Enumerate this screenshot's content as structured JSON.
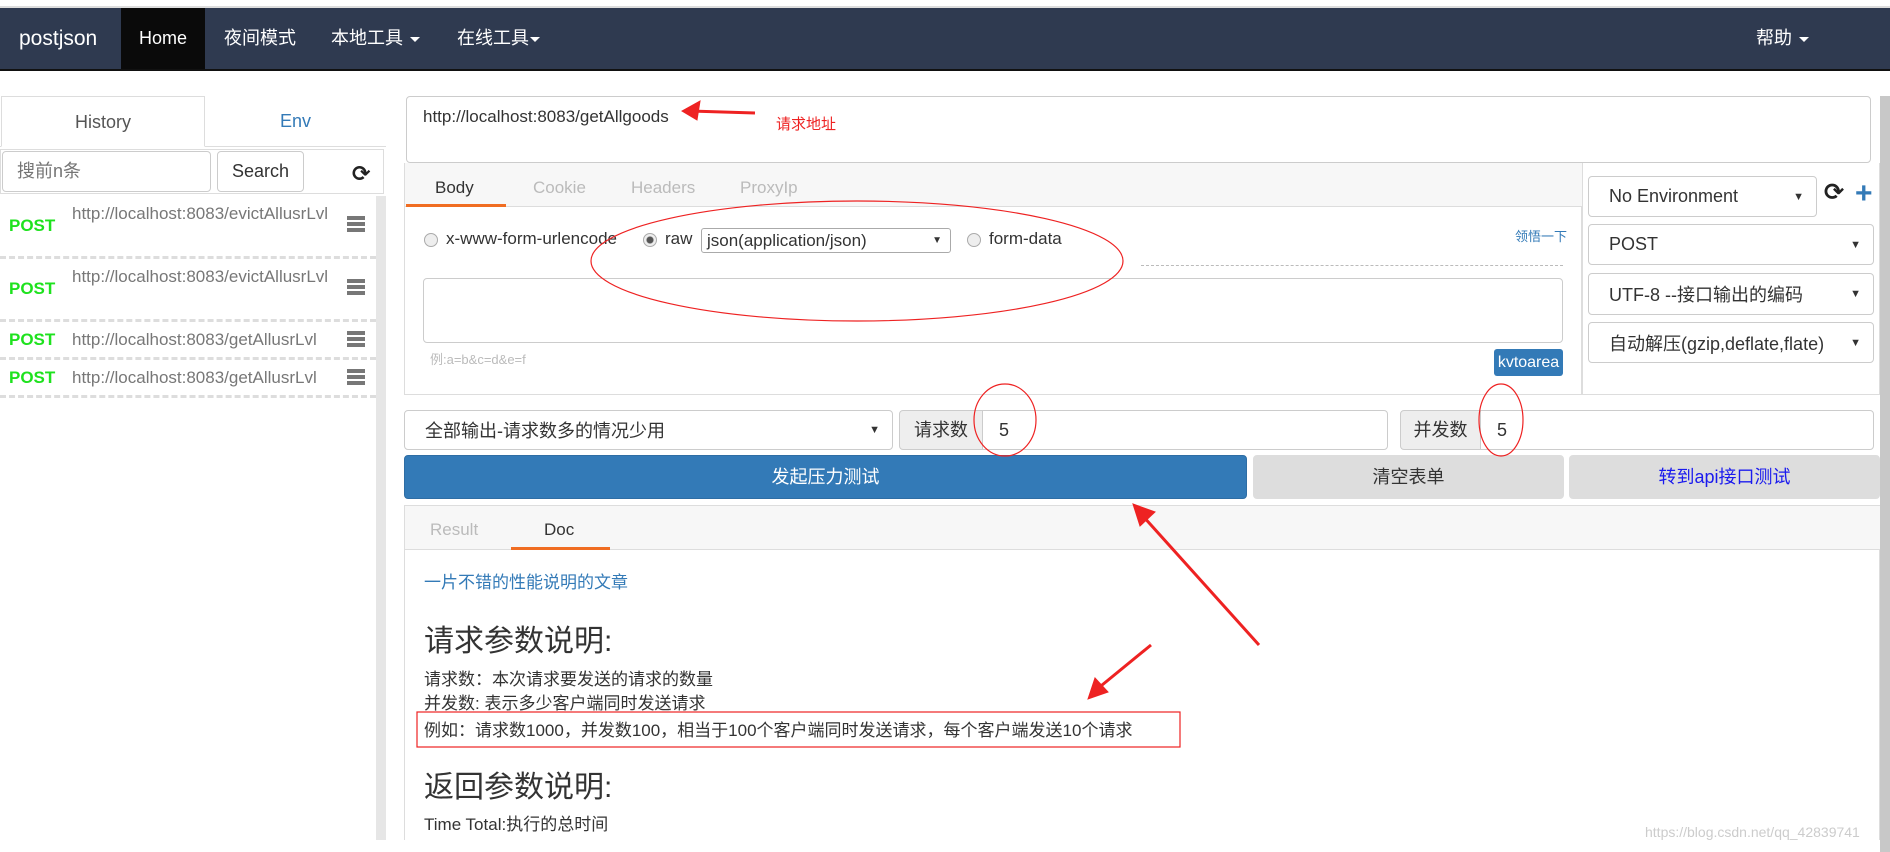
{
  "navbar": {
    "brand": "postjson",
    "items": [
      "Home",
      "夜间模式",
      "本地工具",
      "在线工具"
    ],
    "help": "帮助"
  },
  "sidebar": {
    "tabs": [
      "History",
      "Env"
    ],
    "search_placeholder": "搜前n条",
    "search_button": "Search",
    "history": [
      {
        "method": "POST",
        "url": "http://localhost:8083/evictAllusrLvl"
      },
      {
        "method": "POST",
        "url": "http://localhost:8083/evictAllusrLvl"
      },
      {
        "method": "POST",
        "url": "http://localhost:8083/getAllusrLvl"
      },
      {
        "method": "POST",
        "url": "http://localhost:8083/getAllusrLvl"
      }
    ]
  },
  "request": {
    "url": "http://localhost:8083/getAllgoods",
    "annotation": "请求地址",
    "tabs": [
      "Body",
      "Cookie",
      "Headers",
      "ProxyIp"
    ],
    "body_types": [
      "x-www-form-urlencode",
      "raw",
      "form-data"
    ],
    "raw_type": "json(application/json)",
    "hint_link": "领悟一下",
    "body_hint": "例:a=b&c=d&e=f",
    "kv_button": "kvtoarea"
  },
  "settings": {
    "environment": "No Environment",
    "method": "POST",
    "encoding": "UTF-8 --接口输出的编码",
    "decompress": "自动解压(gzip,deflate,flate)"
  },
  "stress": {
    "output_mode": "全部输出-请求数多的情况少用",
    "requests_label": "请求数",
    "requests": "5",
    "concurrency_label": "并发数",
    "concurrency": "5",
    "start_button": "发起压力测试",
    "clear_button": "清空表单",
    "api_button": "转到api接口测试"
  },
  "result": {
    "tabs": [
      "Result",
      "Doc"
    ],
    "link": "一片不错的性能说明的文章",
    "heading1": "请求参数说明:",
    "line1": "请求数：本次请求要发送的请求的数量",
    "line2": "并发数: 表示多少客户端同时发送请求",
    "line3": "例如：请求数1000，并发数100，相当于100个客户端同时发送请求，每个客户端发送10个请求",
    "heading2": "返回参数说明:",
    "line4": "Time Total:执行的总时间"
  },
  "watermark": "https://blog.csdn.net/qq_42839741",
  "colors": {
    "navbar": "#2f3a50",
    "primary": "#337ab7",
    "post": "#1ee21e",
    "accent": "#f06d22",
    "annotation": "#ee2222"
  }
}
